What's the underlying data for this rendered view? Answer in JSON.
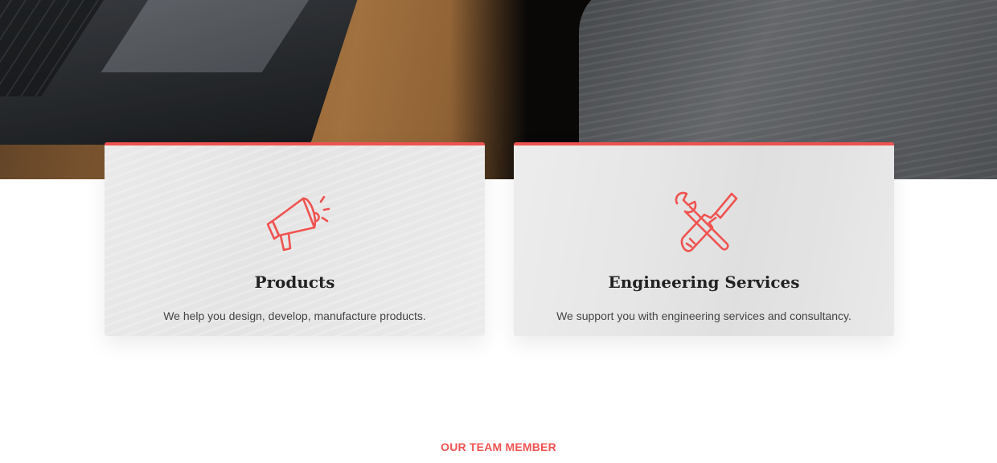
{
  "services": [
    {
      "title": "Products",
      "description": "We help you design, develop, manufacture products.",
      "icon": "megaphone-icon"
    },
    {
      "title": "Engineering Services",
      "description": "We support you with engineering services and consultancy.",
      "icon": "wrench-screwdriver-icon"
    }
  ],
  "team": {
    "section_label": "OUR TEAM MEMBER"
  },
  "colors": {
    "accent": "#ef5350",
    "heading": "#222222",
    "body_text": "#444444"
  }
}
